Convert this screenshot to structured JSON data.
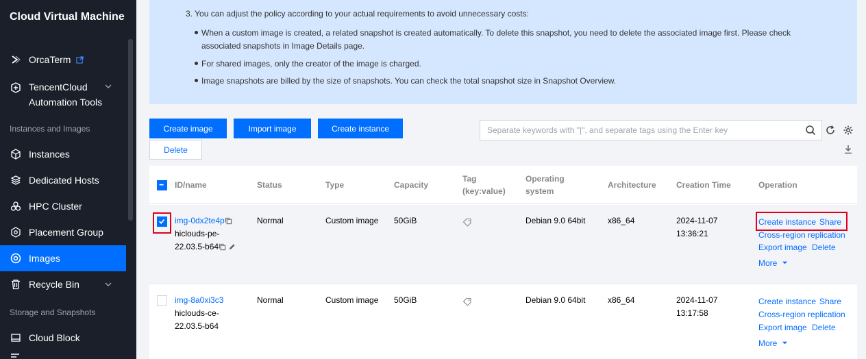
{
  "sidebar": {
    "title": "Cloud Virtual Machine",
    "items_top": [
      {
        "label": "OrcaTerm",
        "icon": "terminal-icon"
      },
      {
        "label": "TencentCloud",
        "label2": "Automation Tools",
        "icon": "automation-icon"
      }
    ],
    "section_instances": "Instances and Images",
    "items_mid": [
      {
        "label": "Instances",
        "icon": "cube-icon"
      },
      {
        "label": "Dedicated Hosts",
        "icon": "layers-icon"
      },
      {
        "label": "HPC Cluster",
        "icon": "cluster-icon"
      },
      {
        "label": "Placement Group",
        "icon": "placement-icon"
      },
      {
        "label": "Images",
        "icon": "image-icon"
      },
      {
        "label": "Recycle Bin",
        "icon": "recycle-bin-icon"
      }
    ],
    "section_storage": "Storage and Snapshots",
    "items_bottom": [
      {
        "label": "Cloud Block",
        "icon": "disk-icon"
      }
    ]
  },
  "notice": {
    "line1": "3. You can adjust the policy according to your actual requirements to avoid unnecessary costs:",
    "bullet1a": "When a custom image is created, a related snapshot is created automatically. To delete this snapshot, you need to delete the associated image first. Please check",
    "bullet1b": "associated snapshots in Image Details page.",
    "bullet2": "For shared images, only the creator of the image is charged.",
    "bullet3": "Image snapshots are billed by the size of snapshots. You can check the total snapshot size in Snapshot Overview."
  },
  "toolbar": {
    "create_image": "Create image",
    "import_image": "Import image",
    "create_instance": "Create instance",
    "delete": "Delete",
    "search_placeholder": "Separate keywords with \"|\", and separate tags using the Enter key"
  },
  "table": {
    "headers": {
      "id_name": "ID/name",
      "status": "Status",
      "type": "Type",
      "capacity": "Capacity",
      "tag1": "Tag",
      "tag2": "(key:value)",
      "os1": "Operating",
      "os2": "system",
      "arch": "Architecture",
      "created": "Creation Time",
      "operation": "Operation"
    },
    "rows": [
      {
        "selected": true,
        "id": "img-0dx2te4p",
        "name1": "hiclouds-pe-",
        "name2": "22.03.5-b64",
        "status": "Normal",
        "type": "Custom image",
        "capacity": "50GiB",
        "os": "Debian 9.0 64bit",
        "arch": "x86_64",
        "date": "2024-11-07",
        "time": "13:36:21",
        "op_create": "Create instance",
        "op_share": "Share",
        "op_replicate": "Cross-region replication",
        "op_export": "Export image",
        "op_delete": "Delete",
        "op_more": "More"
      },
      {
        "selected": false,
        "id": "img-8a0xi3c3",
        "name1": "hiclouds-ce-",
        "name2": "22.03.5-b64",
        "status": "Normal",
        "type": "Custom image",
        "capacity": "50GiB",
        "os": "Debian 9.0 64bit",
        "arch": "x86_64",
        "date": "2024-11-07",
        "time": "13:17:58",
        "op_create": "Create instance",
        "op_share": "Share",
        "op_replicate": "Cross-region replication",
        "op_export": "Export image",
        "op_delete": "Delete",
        "op_more": "More"
      }
    ]
  },
  "colors": {
    "accent": "#006eff",
    "sidebar_bg": "#1b1f2a",
    "notice_bg": "#d5e7ff",
    "highlight": "#e0001b"
  }
}
